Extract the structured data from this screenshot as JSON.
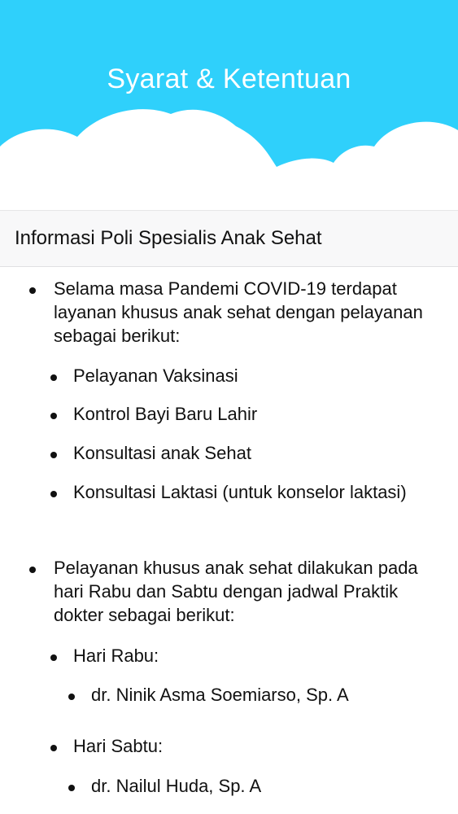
{
  "header": {
    "title": "Syarat & Ketentuan"
  },
  "section": {
    "title": "Informasi Poli Spesialis Anak Sehat"
  },
  "content": {
    "intro1": "Selama masa Pandemi COVID-19 terdapat layanan khusus anak sehat dengan pelayanan sebagai berikut:",
    "services": [
      "Pelayanan Vaksinasi",
      "Kontrol Bayi Baru Lahir",
      "Konsultasi anak Sehat",
      "Konsultasi Laktasi (untuk konselor laktasi)"
    ],
    "intro2": "Pelayanan khusus anak sehat dilakukan pada hari Rabu dan Sabtu dengan jadwal Praktik dokter sebagai berikut:",
    "schedule": [
      {
        "day": "Hari Rabu:",
        "doctor": "dr. Ninik Asma Soemiarso, Sp. A"
      },
      {
        "day": "Hari Sabtu:",
        "doctor": "dr. Nailul Huda, Sp. A"
      }
    ]
  },
  "colors": {
    "header_bg": "#2fd0fb",
    "cloud": "#ffffff",
    "section_bg": "#f8f8f9"
  }
}
